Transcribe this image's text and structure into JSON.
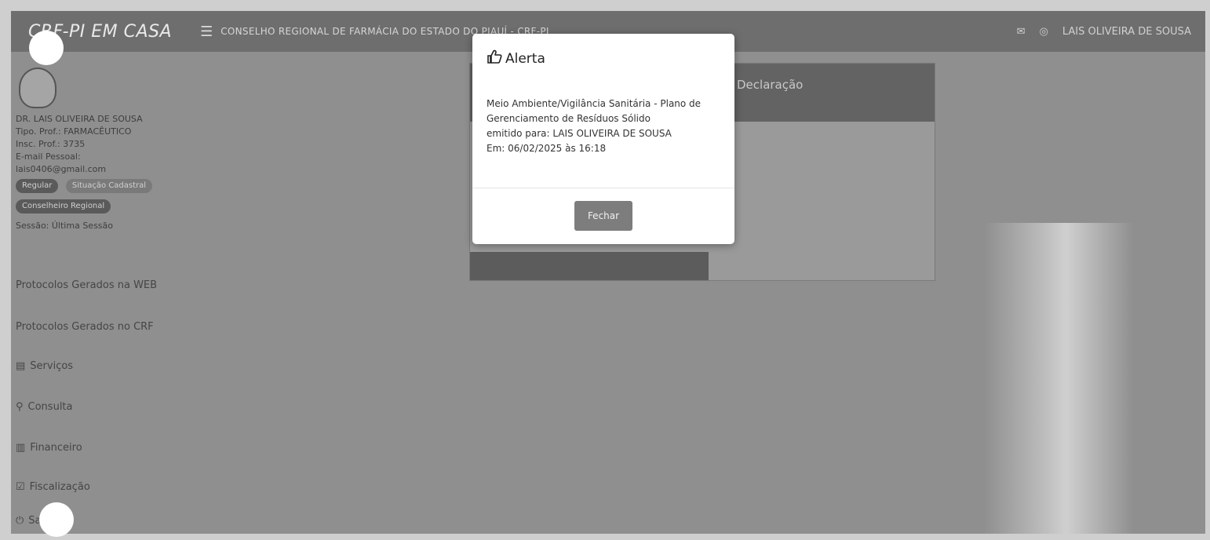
{
  "topbar": {
    "brand": "CRF-PI EM CASA",
    "org_title": "CONSELHO REGIONAL DE FARMÁCIA DO ESTADO DO PIAUÍ - CRF-PI",
    "user": "LAIS OLIVEIRA DE SOUSA"
  },
  "sidebar": {
    "name": "DR. LAIS OLIVEIRA DE SOUSA",
    "prof_type": "Tipo. Prof.: FARMACÊUTICO",
    "insc": "Insc. Prof.: 3735",
    "email_label": "E-mail Pessoal:",
    "email": "lais0406@gmail.com",
    "badge1": "Regular",
    "badge2": "Situação Cadastral",
    "badge3": "Conselheiro Regional",
    "session": "Sessão: Última Sessão",
    "nav": [
      {
        "icon": "",
        "label": "Protocolos Gerados na WEB"
      },
      {
        "icon": "",
        "label": "Protocolos Gerados no CRF"
      },
      {
        "icon": "▤",
        "label": "Serviços"
      },
      {
        "icon": "⚲",
        "label": "Consulta"
      },
      {
        "icon": "▥",
        "label": "Financeiro"
      },
      {
        "icon": "☑",
        "label": "Fiscalização"
      },
      {
        "icon": "⏻",
        "label": "Sair"
      }
    ]
  },
  "background_card": {
    "title": "Declaração"
  },
  "modal": {
    "title": "Alerta",
    "line1": "Meio Ambiente/Vigilância Sanitária - Plano de",
    "line2": "Gerenciamento de Resíduos Sólido",
    "line3": "emitido para: LAIS OLIVEIRA DE SOUSA",
    "line4": "Em: 06/02/2025 às 16:18",
    "close_label": "Fechar"
  }
}
